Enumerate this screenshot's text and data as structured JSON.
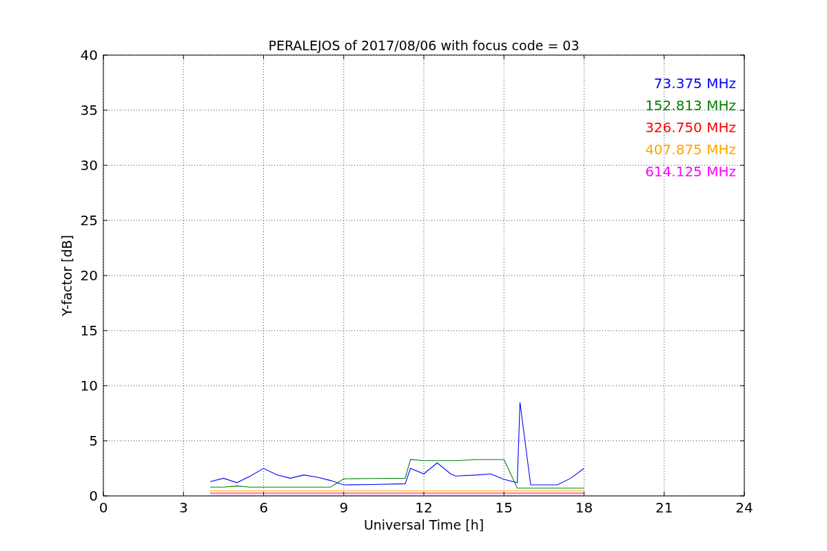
{
  "chart_data": {
    "type": "line",
    "title": "PERALEJOS of 2017/08/06 with focus code = 03",
    "xlabel": "Universal Time [h]",
    "ylabel": "Y-factor [dB]",
    "x": [
      4,
      4.5,
      5,
      5.5,
      6,
      6.5,
      7,
      7.5,
      8,
      8.5,
      9,
      10,
      11.3,
      11.5,
      12,
      12.5,
      13,
      13.2,
      14,
      14.5,
      15,
      15.5,
      15.6,
      16,
      17,
      17.5,
      18
    ],
    "series": [
      {
        "name": "73.375 MHz",
        "color": "#0000ff",
        "values": [
          1.3,
          1.6,
          1.2,
          1.8,
          2.5,
          1.9,
          1.6,
          1.9,
          1.7,
          1.4,
          1.0,
          1.03,
          1.1,
          2.5,
          2.0,
          3.0,
          2.0,
          1.8,
          1.9,
          2.0,
          1.5,
          1.2,
          8.5,
          1.0,
          1.0,
          1.6,
          2.5
        ]
      },
      {
        "name": "152.813 MHz",
        "color": "#008000",
        "values": [
          0.8,
          0.8,
          0.9,
          0.8,
          0.8,
          0.8,
          0.8,
          0.8,
          0.8,
          0.8,
          1.55,
          1.58,
          1.6,
          3.3,
          3.2,
          3.2,
          3.2,
          3.2,
          3.3,
          3.3,
          3.3,
          0.7,
          0.7,
          0.7,
          0.7,
          0.7,
          0.7
        ]
      },
      {
        "name": "326.750 MHz",
        "color": "#ff0000",
        "values": [
          0.25,
          0.25,
          0.25,
          0.25,
          0.25,
          0.25,
          0.25,
          0.25,
          0.25,
          0.25,
          0.25,
          0.25,
          0.25,
          0.25,
          0.25,
          0.25,
          0.25,
          0.25,
          0.25,
          0.25,
          0.25,
          0.25,
          0.25,
          0.25,
          0.25,
          0.25,
          0.25
        ]
      },
      {
        "name": "407.875 MHz",
        "color": "#ffa500",
        "values": [
          0.45,
          0.45,
          0.45,
          0.45,
          0.45,
          0.45,
          0.45,
          0.45,
          0.45,
          0.45,
          0.45,
          0.45,
          0.45,
          0.45,
          0.45,
          0.45,
          0.45,
          0.45,
          0.45,
          0.45,
          0.45,
          0.45,
          0.45,
          0.45,
          0.45,
          0.45,
          0.45
        ]
      },
      {
        "name": "614.125 MHz",
        "color": "#ff00ff",
        "values": [
          0.05,
          0.05,
          0.05,
          0.05,
          0.05,
          0.05,
          0.05,
          0.05,
          0.05,
          0.05,
          0.05,
          0.05,
          0.05,
          0.05,
          0.05,
          0.05,
          0.05,
          0.05,
          0.05,
          0.05,
          0.05,
          0.05,
          0.05,
          0.05,
          0.05,
          0.05,
          0.05
        ]
      }
    ],
    "xlim": [
      0,
      24
    ],
    "ylim": [
      0,
      40
    ],
    "xticks": [
      0,
      3,
      6,
      9,
      12,
      15,
      18,
      21,
      24
    ],
    "yticks": [
      0,
      5,
      10,
      15,
      20,
      25,
      30,
      35,
      40
    ],
    "grid": true
  }
}
